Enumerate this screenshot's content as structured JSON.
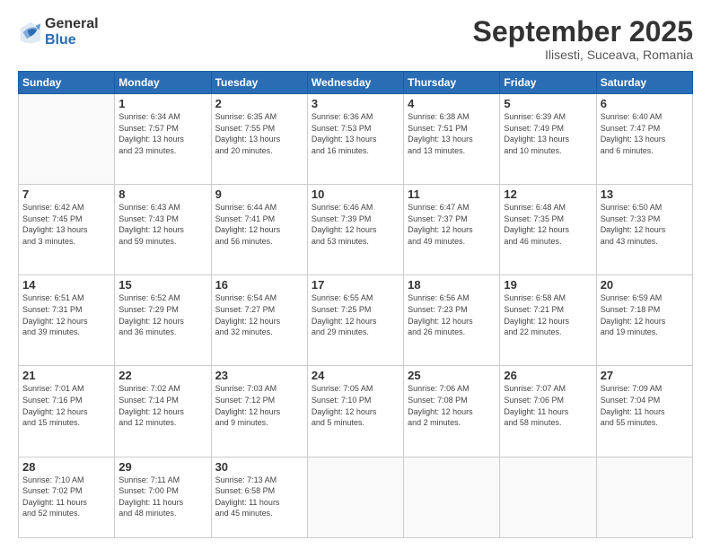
{
  "logo": {
    "general": "General",
    "blue": "Blue"
  },
  "header": {
    "month": "September 2025",
    "location": "Ilisesti, Suceava, Romania"
  },
  "weekdays": [
    "Sunday",
    "Monday",
    "Tuesday",
    "Wednesday",
    "Thursday",
    "Friday",
    "Saturday"
  ],
  "days": [
    {
      "date": "",
      "info": ""
    },
    {
      "date": "1",
      "info": "Sunrise: 6:34 AM\nSunset: 7:57 PM\nDaylight: 13 hours\nand 23 minutes."
    },
    {
      "date": "2",
      "info": "Sunrise: 6:35 AM\nSunset: 7:55 PM\nDaylight: 13 hours\nand 20 minutes."
    },
    {
      "date": "3",
      "info": "Sunrise: 6:36 AM\nSunset: 7:53 PM\nDaylight: 13 hours\nand 16 minutes."
    },
    {
      "date": "4",
      "info": "Sunrise: 6:38 AM\nSunset: 7:51 PM\nDaylight: 13 hours\nand 13 minutes."
    },
    {
      "date": "5",
      "info": "Sunrise: 6:39 AM\nSunset: 7:49 PM\nDaylight: 13 hours\nand 10 minutes."
    },
    {
      "date": "6",
      "info": "Sunrise: 6:40 AM\nSunset: 7:47 PM\nDaylight: 13 hours\nand 6 minutes."
    },
    {
      "date": "7",
      "info": "Sunrise: 6:42 AM\nSunset: 7:45 PM\nDaylight: 13 hours\nand 3 minutes."
    },
    {
      "date": "8",
      "info": "Sunrise: 6:43 AM\nSunset: 7:43 PM\nDaylight: 12 hours\nand 59 minutes."
    },
    {
      "date": "9",
      "info": "Sunrise: 6:44 AM\nSunset: 7:41 PM\nDaylight: 12 hours\nand 56 minutes."
    },
    {
      "date": "10",
      "info": "Sunrise: 6:46 AM\nSunset: 7:39 PM\nDaylight: 12 hours\nand 53 minutes."
    },
    {
      "date": "11",
      "info": "Sunrise: 6:47 AM\nSunset: 7:37 PM\nDaylight: 12 hours\nand 49 minutes."
    },
    {
      "date": "12",
      "info": "Sunrise: 6:48 AM\nSunset: 7:35 PM\nDaylight: 12 hours\nand 46 minutes."
    },
    {
      "date": "13",
      "info": "Sunrise: 6:50 AM\nSunset: 7:33 PM\nDaylight: 12 hours\nand 43 minutes."
    },
    {
      "date": "14",
      "info": "Sunrise: 6:51 AM\nSunset: 7:31 PM\nDaylight: 12 hours\nand 39 minutes."
    },
    {
      "date": "15",
      "info": "Sunrise: 6:52 AM\nSunset: 7:29 PM\nDaylight: 12 hours\nand 36 minutes."
    },
    {
      "date": "16",
      "info": "Sunrise: 6:54 AM\nSunset: 7:27 PM\nDaylight: 12 hours\nand 32 minutes."
    },
    {
      "date": "17",
      "info": "Sunrise: 6:55 AM\nSunset: 7:25 PM\nDaylight: 12 hours\nand 29 minutes."
    },
    {
      "date": "18",
      "info": "Sunrise: 6:56 AM\nSunset: 7:23 PM\nDaylight: 12 hours\nand 26 minutes."
    },
    {
      "date": "19",
      "info": "Sunrise: 6:58 AM\nSunset: 7:21 PM\nDaylight: 12 hours\nand 22 minutes."
    },
    {
      "date": "20",
      "info": "Sunrise: 6:59 AM\nSunset: 7:18 PM\nDaylight: 12 hours\nand 19 minutes."
    },
    {
      "date": "21",
      "info": "Sunrise: 7:01 AM\nSunset: 7:16 PM\nDaylight: 12 hours\nand 15 minutes."
    },
    {
      "date": "22",
      "info": "Sunrise: 7:02 AM\nSunset: 7:14 PM\nDaylight: 12 hours\nand 12 minutes."
    },
    {
      "date": "23",
      "info": "Sunrise: 7:03 AM\nSunset: 7:12 PM\nDaylight: 12 hours\nand 9 minutes."
    },
    {
      "date": "24",
      "info": "Sunrise: 7:05 AM\nSunset: 7:10 PM\nDaylight: 12 hours\nand 5 minutes."
    },
    {
      "date": "25",
      "info": "Sunrise: 7:06 AM\nSunset: 7:08 PM\nDaylight: 12 hours\nand 2 minutes."
    },
    {
      "date": "26",
      "info": "Sunrise: 7:07 AM\nSunset: 7:06 PM\nDaylight: 11 hours\nand 58 minutes."
    },
    {
      "date": "27",
      "info": "Sunrise: 7:09 AM\nSunset: 7:04 PM\nDaylight: 11 hours\nand 55 minutes."
    },
    {
      "date": "28",
      "info": "Sunrise: 7:10 AM\nSunset: 7:02 PM\nDaylight: 11 hours\nand 52 minutes."
    },
    {
      "date": "29",
      "info": "Sunrise: 7:11 AM\nSunset: 7:00 PM\nDaylight: 11 hours\nand 48 minutes."
    },
    {
      "date": "30",
      "info": "Sunrise: 7:13 AM\nSunset: 6:58 PM\nDaylight: 11 hours\nand 45 minutes."
    },
    {
      "date": "",
      "info": ""
    },
    {
      "date": "",
      "info": ""
    },
    {
      "date": "",
      "info": ""
    },
    {
      "date": "",
      "info": ""
    }
  ]
}
